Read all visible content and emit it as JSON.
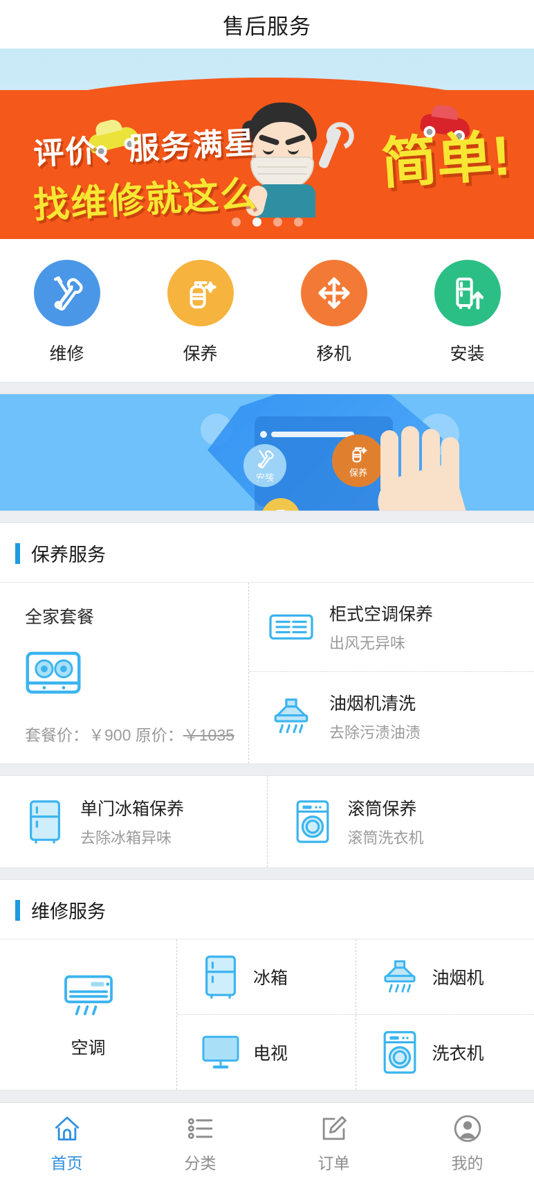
{
  "header": {
    "title": "售后服务"
  },
  "hero": {
    "line1": "评价、服务满星",
    "line2": "找维修就这么",
    "big": "简单!",
    "dots": 4,
    "active_dot": 1,
    "bg_color": "#f4581b",
    "sky_color": "#c9e9f7",
    "yellow_text_color": "#f7e733"
  },
  "categories": [
    {
      "label": "维修",
      "icon": "tools-icon",
      "color": "#4a97e8"
    },
    {
      "label": "保养",
      "icon": "spray-bottle-icon",
      "color": "#f6b33d"
    },
    {
      "label": "移机",
      "icon": "move-arrows-icon",
      "color": "#f37a36"
    },
    {
      "label": "安装",
      "icon": "fridge-install-icon",
      "color": "#2bbf86"
    }
  ],
  "promo": {
    "bg_color": "#6ec1fa",
    "bubbles": [
      {
        "label": "安装",
        "icon": "tools-icon",
        "color": "#9cd3f7"
      },
      {
        "label": "保养",
        "icon": "spray-bottle-icon",
        "color": "#e0802f"
      }
    ]
  },
  "care_section": {
    "title": "保养服务",
    "accent_color": "#1f9ae0",
    "package": {
      "title": "全家套餐",
      "icon": "gas-stove-icon",
      "price_label": "套餐价：",
      "price": "￥900",
      "original_label": "原价：",
      "original_price": "￥1035"
    },
    "items": [
      {
        "name": "柜式空调保养",
        "sub": "出风无异味",
        "icon": "cabinet-ac-icon"
      },
      {
        "name": "油烟机清洗",
        "sub": "去除污渍油渍",
        "icon": "range-hood-icon"
      }
    ],
    "row2": [
      {
        "name": "单门冰箱保养",
        "sub": "去除冰箱异味",
        "icon": "fridge-icon"
      },
      {
        "name": "滚筒保养",
        "sub": "滚筒洗衣机",
        "icon": "washer-icon"
      }
    ]
  },
  "repair_section": {
    "title": "维修服务",
    "accent_color": "#1f9ae0",
    "featured": {
      "label": "空调",
      "icon": "split-ac-icon"
    },
    "items": [
      {
        "label": "冰箱",
        "icon": "fridge-icon"
      },
      {
        "label": "油烟机",
        "icon": "range-hood-icon"
      },
      {
        "label": "电视",
        "icon": "tv-icon"
      },
      {
        "label": "洗衣机",
        "icon": "washer-icon"
      }
    ]
  },
  "tabbar": {
    "active_color": "#2f8fe0",
    "inactive_color": "#8d8d8d",
    "tabs": [
      {
        "label": "首页",
        "icon": "home-icon",
        "active": true
      },
      {
        "label": "分类",
        "icon": "list-icon",
        "active": false
      },
      {
        "label": "订单",
        "icon": "order-edit-icon",
        "active": false
      },
      {
        "label": "我的",
        "icon": "user-icon",
        "active": false
      }
    ]
  }
}
